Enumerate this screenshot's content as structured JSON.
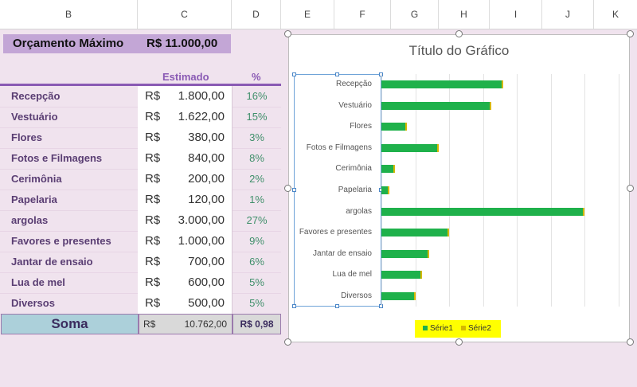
{
  "columns": [
    "B",
    "C",
    "D",
    "E",
    "F",
    "G",
    "H",
    "I",
    "J",
    "K"
  ],
  "budget": {
    "label": "Orçamento Máximo",
    "value": "R$  11.000,00"
  },
  "table": {
    "header_estimado": "Estimado",
    "header_pct": "%",
    "currency": "R$",
    "rows": [
      {
        "category": "Recepção",
        "value": "1.800,00",
        "pct": "16%"
      },
      {
        "category": "Vestuário",
        "value": "1.622,00",
        "pct": "15%"
      },
      {
        "category": "Flores",
        "value": "380,00",
        "pct": "3%"
      },
      {
        "category": "Fotos e Filmagens",
        "value": "840,00",
        "pct": "8%"
      },
      {
        "category": "Cerimônia",
        "value": "200,00",
        "pct": "2%"
      },
      {
        "category": "Papelaria",
        "value": "120,00",
        "pct": "1%"
      },
      {
        "category": "argolas",
        "value": "3.000,00",
        "pct": "27%"
      },
      {
        "category": "Favores e presentes",
        "value": "1.000,00",
        "pct": "9%"
      },
      {
        "category": "Jantar de ensaio",
        "value": "700,00",
        "pct": "6%"
      },
      {
        "category": "Lua de mel",
        "value": "600,00",
        "pct": "5%"
      },
      {
        "category": "Diversos",
        "value": "500,00",
        "pct": "5%"
      }
    ],
    "total": {
      "label": "Soma",
      "currency": "R$",
      "value": "10.762,00",
      "pct": "R$ 0,98"
    }
  },
  "chart_data": {
    "type": "bar",
    "orientation": "horizontal",
    "title": "Título do Gráfico",
    "categories": [
      "Recepção",
      "Vestuário",
      "Flores",
      "Fotos e Filmagens",
      "Cerimônia",
      "Papelaria",
      "argolas",
      "Favores e presentes",
      "Jantar de ensaio",
      "Lua de mel",
      "Diversos"
    ],
    "series": [
      {
        "name": "Série1",
        "values": [
          1800,
          1622,
          380,
          840,
          200,
          120,
          3000,
          1000,
          700,
          600,
          500
        ],
        "color": "#1fb14b"
      },
      {
        "name": "Série2",
        "values": [
          0.16,
          0.15,
          0.03,
          0.08,
          0.02,
          0.01,
          0.27,
          0.09,
          0.06,
          0.05,
          0.05
        ],
        "color": "#d4b800"
      }
    ],
    "xlim": [
      0,
      3500
    ],
    "grid": true,
    "legend": "bottom"
  }
}
